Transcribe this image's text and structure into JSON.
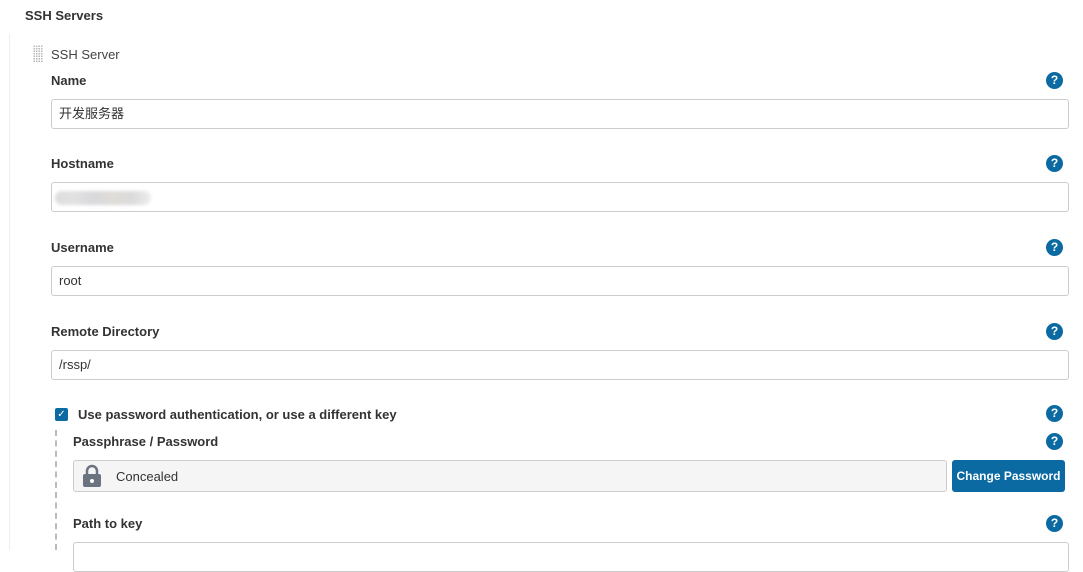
{
  "section": {
    "title": "SSH Servers"
  },
  "server": {
    "title": "SSH Server",
    "fields": {
      "name": {
        "label": "Name",
        "value": "开发服务器"
      },
      "hostname": {
        "label": "Hostname",
        "value": ""
      },
      "username": {
        "label": "Username",
        "value": "root"
      },
      "remote_directory": {
        "label": "Remote Directory",
        "value": "/rssp/"
      }
    },
    "use_password": {
      "label": "Use password authentication, or use a different key",
      "checked": true
    },
    "passphrase": {
      "label": "Passphrase / Password",
      "value": "Concealed",
      "change_button": "Change Password"
    },
    "path_to_key": {
      "label": "Path to key",
      "value": ""
    }
  },
  "help_icon_glyph": "?",
  "colors": {
    "accent": "#0b6aa2"
  }
}
